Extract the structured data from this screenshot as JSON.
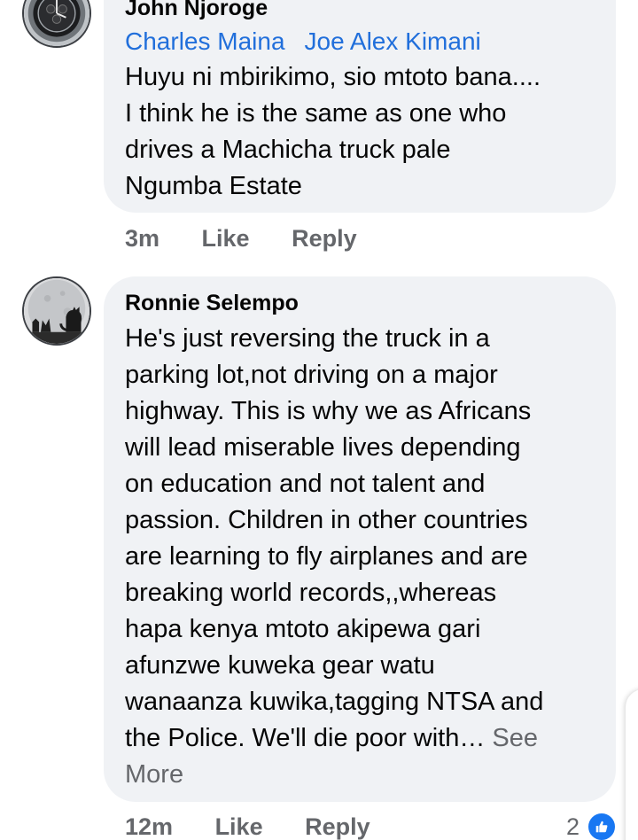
{
  "comments": [
    {
      "author": "John Njoroge",
      "tags": [
        "Charles Maina",
        "Joe Alex Kimani"
      ],
      "text_lines": [
        "Huyu ni mbirikimo,  sio mtoto bana....",
        "I think he is the same as one who",
        "drives a Machicha truck pale",
        "Ngumba Estate"
      ],
      "time": "3m",
      "like_label": "Like",
      "reply_label": "Reply",
      "avatar_icon": "watch-avatar-icon"
    },
    {
      "author": "Ronnie Selempo",
      "text_lines": [
        "He's just reversing the truck in a",
        "parking lot,not driving on a major",
        "highway. This is why we as Africans",
        "will lead miserable lives depending",
        "on education and not talent and",
        "passion. Children in other countries",
        "are learning to fly airplanes and are",
        "breaking world records,,whereas",
        "hapa kenya mtoto akipewa gari",
        "afunzwe kuweka gear watu",
        "wanaanza kuwika,tagging NTSA and",
        "the Police. We'll die poor with…"
      ],
      "see_more_first": "See",
      "see_more_second": "More",
      "time": "12m",
      "like_label": "Like",
      "reply_label": "Reply",
      "reaction_count": "2",
      "reaction_icon": "like-thumb-icon",
      "avatar_icon": "moon-cat-avatar-icon"
    }
  ],
  "colors": {
    "bubble": "#f0f2f5",
    "tag": "#216fdb",
    "meta": "#65676b",
    "like_badge": "#1877f2"
  }
}
